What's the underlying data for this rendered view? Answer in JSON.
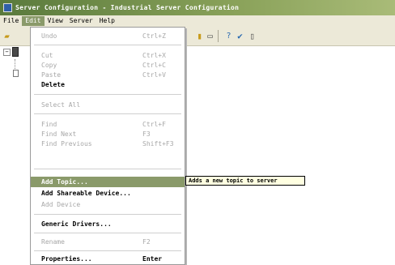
{
  "window": {
    "title": "Server Configuration - Industrial Server Configuration"
  },
  "menubar": {
    "items": [
      "File",
      "Edit",
      "View",
      "Server",
      "Help"
    ]
  },
  "edit_menu": {
    "items": [
      {
        "label": "Undo",
        "shortcut": "Ctrl+Z"
      },
      {
        "label": "Cut",
        "shortcut": "Ctrl+X"
      },
      {
        "label": "Copy",
        "shortcut": "Ctrl+C"
      },
      {
        "label": "Paste",
        "shortcut": "Ctrl+V"
      },
      {
        "label": "Delete",
        "shortcut": ""
      },
      {
        "label": "Select All",
        "shortcut": ""
      },
      {
        "label": "Find",
        "shortcut": "Ctrl+F"
      },
      {
        "label": "Find Next",
        "shortcut": "F3"
      },
      {
        "label": "Find Previous",
        "shortcut": "Shift+F3"
      },
      {
        "label": "Add Topic...",
        "shortcut": ""
      },
      {
        "label": "Add Shareable Device...",
        "shortcut": ""
      },
      {
        "label": "Add Device",
        "shortcut": ""
      },
      {
        "label": "Generic Drivers...",
        "shortcut": ""
      },
      {
        "label": "Rename",
        "shortcut": "F2"
      },
      {
        "label": "Properties...",
        "shortcut": "Enter"
      }
    ]
  },
  "tooltip": {
    "text": "Adds a new topic to server"
  },
  "toolbar": {
    "icons": [
      "open-icon",
      "properties-icon",
      "help-icon",
      "check-icon",
      "clipboard-icon"
    ]
  }
}
